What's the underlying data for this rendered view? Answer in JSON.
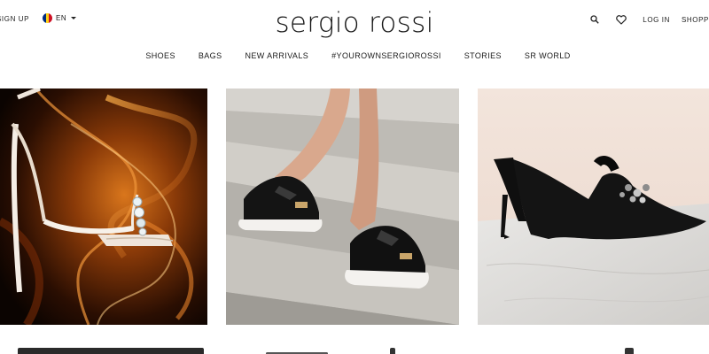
{
  "header": {
    "signup_label": "SIGN UP",
    "language_label": "EN",
    "logo_text": "sergio rossi",
    "login_label": "LOG IN",
    "shopping_label": "SHOPP"
  },
  "nav": {
    "items": [
      {
        "label": "SHOES"
      },
      {
        "label": "BAGS"
      },
      {
        "label": "NEW ARRIVALS"
      },
      {
        "label": "#YOUROWNSERGIOROSSI"
      },
      {
        "label": "STORIES"
      },
      {
        "label": "SR WORLD"
      }
    ]
  },
  "icons": {
    "search": "search-icon",
    "wishlist": "heart-icon",
    "language": "romania-flag-icon",
    "dropdown": "chevron-down-icon"
  },
  "colors": {
    "flag": [
      "#002b7f",
      "#fcd116",
      "#ce1126"
    ]
  }
}
